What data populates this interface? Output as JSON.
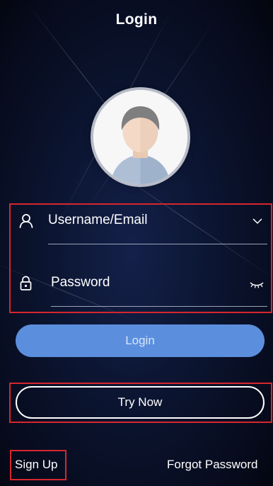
{
  "header": {
    "title": "Login"
  },
  "form": {
    "username_value": "Username/Email",
    "password_value": "Password",
    "username_icon": "user-icon",
    "password_icon": "lock-icon",
    "dropdown_icon": "chevron-down-icon",
    "visibility_icon": "eye-closed-icon"
  },
  "buttons": {
    "login_label": "Login",
    "try_now_label": "Try Now"
  },
  "footer": {
    "sign_up_label": "Sign Up",
    "forgot_password_label": "Forgot Password"
  },
  "colors": {
    "background": "#0a0f24",
    "login_button": "#5b8fdd",
    "highlight_outline": "#d7262e",
    "text": "#ffffff"
  }
}
